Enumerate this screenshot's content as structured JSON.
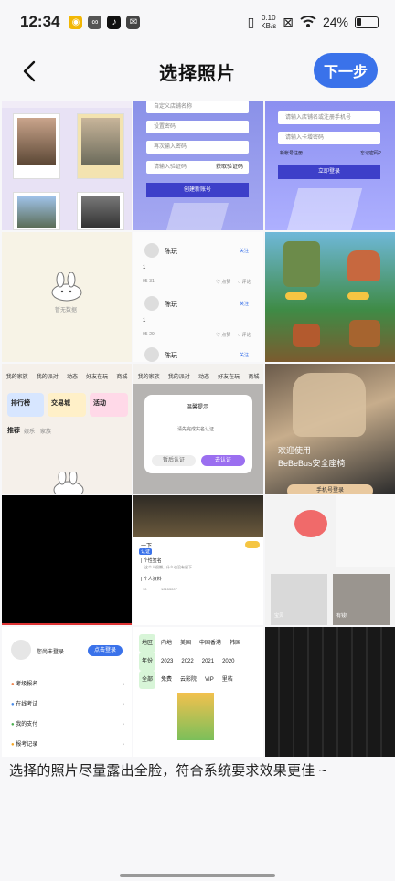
{
  "status_bar": {
    "time": "12:34",
    "net_speed_value": "0.10",
    "net_speed_unit": "KB/s",
    "battery": "24%"
  },
  "header": {
    "title": "选择照片",
    "next_label": "下一步"
  },
  "thumbnails": {
    "t2": {
      "f1": "自定义店铺名称",
      "f2": "设置密码",
      "f3": "再次输入密码",
      "f4": "请输入验证码",
      "code": "获取验证码",
      "button": "创建新账号"
    },
    "t3": {
      "f1": "请输入店铺名或注册手机号",
      "f2": "请输入卡增密码",
      "tip": "新帐号注册",
      "forgot": "忘记密码?",
      "button": "立即登录"
    },
    "t4": {
      "empty": "暂无数据"
    },
    "t5": {
      "name": "陈玩",
      "follow": "关注",
      "num": "1",
      "time1": "05-31",
      "time2": "05-29",
      "like": "点赞",
      "comment": "评论"
    },
    "t7": {
      "nav": [
        "我的家族",
        "我的派对",
        "动态",
        "好友在玩",
        "商城"
      ],
      "card1": "排行榜",
      "card2": "交易城",
      "card3": "活动",
      "tab1": "推荐",
      "tab2": "娱乐",
      "tab3": "家族"
    },
    "t8": {
      "nav": [
        "我的家族",
        "我的派对",
        "动态",
        "好友在玩",
        "商城"
      ],
      "dialog_title": "温馨提示",
      "dialog_text": "请先完成实名认证",
      "cancel": "暂后认证",
      "confirm": "去认证"
    },
    "t9": {
      "line1": "欢迎使用",
      "line2": "BeBeBus安全座椅",
      "button": "手机号登录"
    },
    "t11": {
      "name": "一下",
      "badge": "认证",
      "sign_label": "个性签名",
      "sign_text": "这个人很懒，什么也没有留下",
      "info_label": "个人资料",
      "info_num": "10",
      "info_id": "10153007"
    },
    "t12": {
      "label1": "宝贝",
      "label2": "有钱!"
    },
    "t13": {
      "login": "您尚未登录",
      "login_btn": "点击登录",
      "menu": [
        "考级报名",
        "在线考试",
        "我的支付",
        "报考记录"
      ]
    },
    "t14": {
      "row1": [
        "地区",
        "内地",
        "美国",
        "中国香港",
        "韩国"
      ],
      "row2": [
        "年份",
        "2023",
        "2022",
        "2021",
        "2020"
      ],
      "row3": [
        "全部",
        "免费",
        "云影院",
        "VIP",
        "里桔"
      ]
    }
  },
  "hint": "选择的照片尽量露出全脸，符合系统要求效果更佳 ~"
}
